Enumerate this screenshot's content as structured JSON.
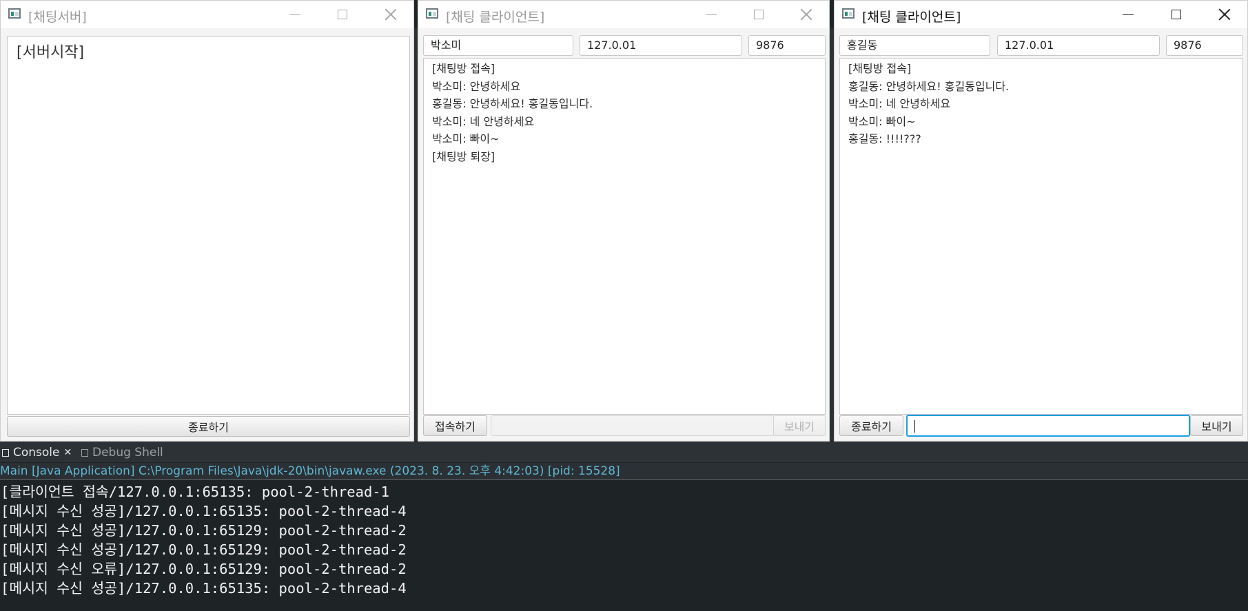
{
  "server_window": {
    "title": "[채팅서버]",
    "log": "[서버시작]",
    "stop_button": "종료하기"
  },
  "client1_window": {
    "title": "[채팅 클라이언트]",
    "name": "박소미",
    "ip": "127.0.01",
    "port": "9876",
    "messages": [
      "[채팅방 접속]",
      "박소미: 안녕하세요",
      "홍길동: 안녕하세요! 홍길동입니다.",
      "박소미: 네 안녕하세요",
      "박소미: 빠이~",
      "[채팅방 퇴장]"
    ],
    "connect_button": "접속하기",
    "input_value": "",
    "send_button": "보내기"
  },
  "client2_window": {
    "title": "[채팅 클라이언트]",
    "name": "홍길동",
    "ip": "127.0.01",
    "port": "9876",
    "messages": [
      "[채팅방 접속]",
      "홍길동: 안녕하세요! 홍길동입니다.",
      "박소미: 네 안녕하세요",
      "박소미: 빠이~",
      "홍길동: !!!!???"
    ],
    "connect_button": "종료하기",
    "input_value": "",
    "send_button": "보내기"
  },
  "console": {
    "tabs": [
      "Console",
      "Debug Shell"
    ],
    "launch": "Main [Java Application] C:\\Program Files\\Java\\jdk-20\\bin\\javaw.exe  (2023. 8. 23. 오후 4:42:03) [pid: 15528]",
    "lines": [
      "[클라이언트 접속/127.0.0.1:65135: pool-2-thread-1",
      "[메시지 수신 성공]/127.0.0.1:65135: pool-2-thread-4",
      "[메시지 수신 성공]/127.0.0.1:65129: pool-2-thread-2",
      "[메시지 수신 성공]/127.0.0.1:65129: pool-2-thread-2",
      "[메시지 수신 오류]/127.0.0.1:65129: pool-2-thread-2",
      "[메시지 수신 성공]/127.0.0.1:65135: pool-2-thread-4"
    ]
  },
  "colors": {
    "focus_accent": "#1e9fe0",
    "launch_text": "#5fb6d3",
    "console_bg": "#1e2326"
  }
}
